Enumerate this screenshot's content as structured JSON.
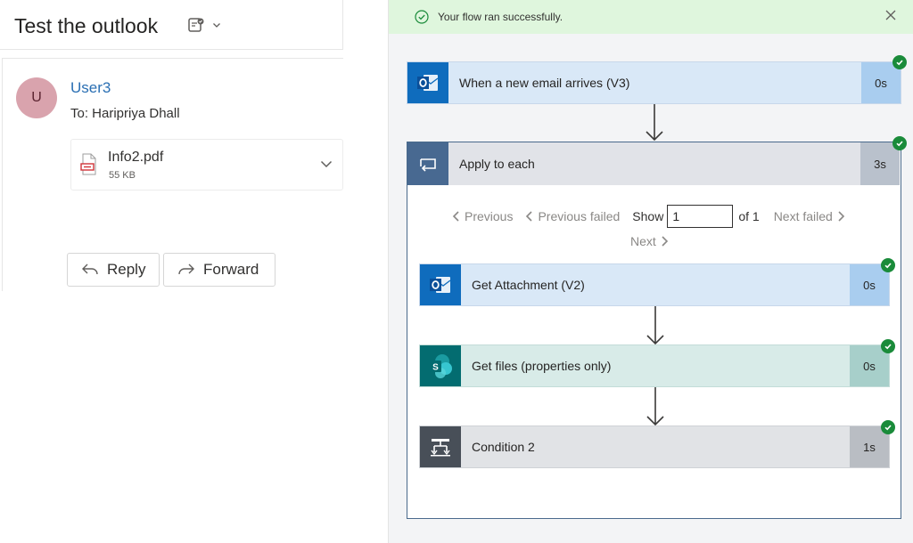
{
  "outlook": {
    "title": "Test the outlook",
    "avatar_initial": "U",
    "sender": "User3",
    "recipient": "To:  Haripriya Dhall",
    "attachment": {
      "name": "Info2.pdf",
      "size": "55 KB"
    },
    "reply_label": "Reply",
    "forward_label": "Forward"
  },
  "flow": {
    "banner_text": "Your flow ran successfully.",
    "trigger": {
      "label": "When a new email arrives (V3)",
      "duration": "0s"
    },
    "scope": {
      "label": "Apply to each",
      "duration": "3s"
    },
    "pager": {
      "previous": "Previous",
      "previous_failed": "Previous failed",
      "show": "Show",
      "value": "1",
      "of": "of 1",
      "next_failed": "Next failed",
      "next": "Next"
    },
    "actions": [
      {
        "label": "Get Attachment (V2)",
        "duration": "0s"
      },
      {
        "label": "Get files (properties only)",
        "duration": "0s"
      },
      {
        "label": "Condition 2",
        "duration": "1s"
      }
    ],
    "colors": {
      "success": "#1a8b3a",
      "banner": "#dff6dd",
      "outlook": "#0f6cbd",
      "sharepoint": "#036c70",
      "condition": "#484f58"
    }
  }
}
